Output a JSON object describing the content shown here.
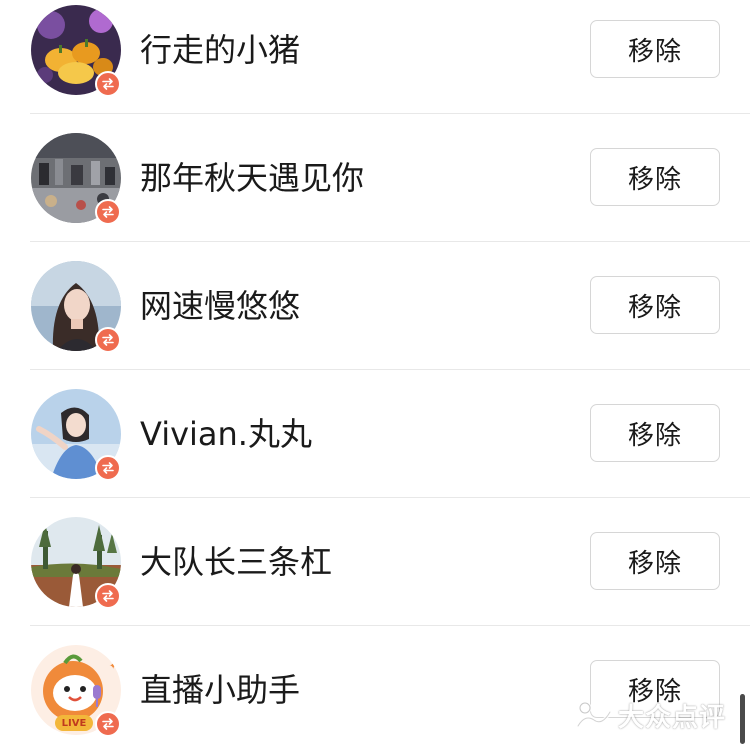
{
  "follow_list": {
    "items": [
      {
        "name": "行走的小猪",
        "action_label": "移除"
      },
      {
        "name": "那年秋天遇见你",
        "action_label": "移除"
      },
      {
        "name": "网速慢悠悠",
        "action_label": "移除"
      },
      {
        "name": "Vivian.丸丸",
        "action_label": "移除"
      },
      {
        "name": "大队长三条杠",
        "action_label": "移除"
      },
      {
        "name": "直播小助手",
        "action_label": "移除",
        "avatar_tag": "LIVE"
      }
    ]
  },
  "badge": {
    "icon": "swap-arrows-icon",
    "color": "#ef6b4f"
  },
  "watermark": {
    "text": "大众点评"
  },
  "colors": {
    "text": "#1a1a1a",
    "divider": "#e8e8e8",
    "button_border": "#d6d6d6"
  }
}
